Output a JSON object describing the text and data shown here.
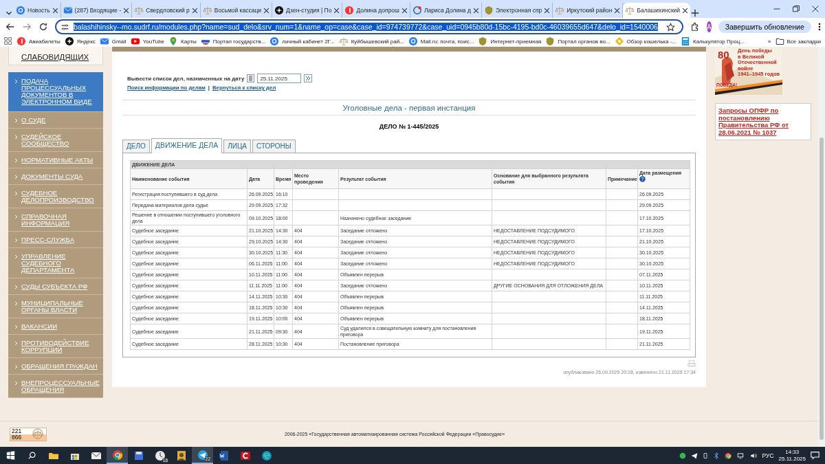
{
  "browser": {
    "tabs": [
      {
        "title": "Новость",
        "selected": false
      },
      {
        "title": "(287) Входящие -",
        "selected": false
      },
      {
        "title": "Свердловский р",
        "selected": false
      },
      {
        "title": "Восьмой кассаци",
        "selected": false
      },
      {
        "title": "Дзен-студия | По",
        "selected": false
      },
      {
        "title": "Долина допрош",
        "selected": false
      },
      {
        "title": "Лариса Долина д",
        "selected": false
      },
      {
        "title": "Электронная спр",
        "selected": false
      },
      {
        "title": "Иркутский район",
        "selected": false
      },
      {
        "title": "Балашихинский",
        "selected": true
      }
    ],
    "url": "balashihinsky--mo.sudrf.ru/modules.php?name=sud_delo&srv_num=1&name_op=case&case_id=974739772&case_uid=0945b80d-15bc-4195-bd0c-46039655d647&delo_id=1540006",
    "profile": "A",
    "update_button": "Завершить обновление",
    "bookmarks": [
      "Авиабилеты",
      "Яндекс",
      "Gmail",
      "YouTube",
      "Карты",
      "Портал государств...",
      "личный кабинет 2Г...",
      "Куйбышевский рай...",
      "Mail.ru: почта, поис...",
      "Интернет-приемная",
      "Портал органов во...",
      "Обзор кошелька -...",
      "Калькулятор Проц..."
    ],
    "more_bookmarks": "»",
    "all_bookmarks": "Все закладки"
  },
  "page": {
    "accessibility_link": "СЛАБОВИДЯЩИХ",
    "sidebar": [
      {
        "label": "ПОДАЧА ПРОЦЕССУАЛЬНЫХ ДОКУМЕНТОВ В ЭЛЕКТРОННОМ ВИДЕ",
        "selected": true
      },
      {
        "label": "О СУДЕ",
        "selected": false
      },
      {
        "label": "СУДЕЙСКОЕ СООБЩЕСТВО",
        "selected": false
      },
      {
        "label": "НОРМАТИВНЫЕ АКТЫ",
        "selected": false
      },
      {
        "label": "ДОКУМЕНТЫ СУДА",
        "selected": false
      },
      {
        "label": "СУДЕБНОЕ ДЕЛОПРОИЗВОДСТВО",
        "selected": false
      },
      {
        "label": "СПРАВОЧНАЯ ИНФОРМАЦИЯ",
        "selected": false
      },
      {
        "label": "ПРЕСС-СЛУЖБА",
        "selected": false
      },
      {
        "label": "УПРАВЛЕНИЕ СУДЕБНОГО ДЕПАРТАМЕНТА",
        "selected": false
      },
      {
        "label": "СУДЫ СУБЪЕКТА РФ",
        "selected": false
      },
      {
        "label": "МУНИЦИПАЛЬНЫЕ ОРГАНЫ ВЛАСТИ",
        "selected": false
      },
      {
        "label": "ВАКАНСИИ",
        "selected": false
      },
      {
        "label": "ПРОТИВОДЕЙСТВИЕ КОРРУПЦИИ",
        "selected": false
      },
      {
        "label": "ОБРАЩЕНИЯ ГРАЖДАН",
        "selected": false
      },
      {
        "label": "ВНЕПРОЦЕССУАЛЬНЫЕ ОБРАЩЕНИЯ",
        "selected": false
      }
    ],
    "date_filter": {
      "label": "Вывести список дел, назначенных на дату",
      "value": "25.11.2025"
    },
    "links": [
      "Поиск информации по делам",
      "Вернуться к списку дел"
    ],
    "link_separator": "|",
    "section_title": "Уголовные дела - первая инстанция",
    "case_title": "ДЕЛО № 1-445/2025",
    "case_tabs": [
      {
        "label": "ДЕЛО",
        "selected": false
      },
      {
        "label": "ДВИЖЕНИЕ ДЕЛА",
        "selected": true
      },
      {
        "label": "ЛИЦА",
        "selected": false
      },
      {
        "label": "СТОРОНЫ",
        "selected": false
      }
    ],
    "table": {
      "caption": "ДВИЖЕНИЕ ДЕЛА",
      "columns": [
        "Наименование события",
        "Дата",
        "Время",
        "Место проведения",
        "Результат события",
        "Основание для выбранного результата события",
        "Примечание",
        "Дата размещения"
      ],
      "rows": [
        [
          "Регистрация поступившего в суд дела",
          "26.09.2025",
          "16:10",
          "",
          "",
          "",
          "",
          "26.09.2025"
        ],
        [
          "Передача материалов дела судье",
          "29.09.2025",
          "17:32",
          "",
          "",
          "",
          "",
          "29.09.2025"
        ],
        [
          "Решение в отношении поступившего уголовного дела",
          "09.10.2025",
          "18:00",
          "",
          "Назначено судебное заседание",
          "",
          "",
          "17.10.2025"
        ],
        [
          "Судебное заседание",
          "21.10.2025",
          "14:30",
          "404",
          "Заседание отложено",
          "НЕДОСТАВЛЕНИЕ ПОДСУДИМОГО",
          "",
          "17.10.2025"
        ],
        [
          "Судебное заседание",
          "29.10.2025",
          "14:30",
          "404",
          "Заседание отложено",
          "НЕДОСТАВЛЕНИЕ ПОДСУДИМОГО",
          "",
          "21.10.2025"
        ],
        [
          "Судебное заседание",
          "30.10.2025",
          "11:30",
          "404",
          "Заседание отложено",
          "НЕДОСТАВЛЕНИЕ ПОДСУДИМОГО",
          "",
          "30.10.2025"
        ],
        [
          "Судебное заседание",
          "06.11.2025",
          "11:00",
          "404",
          "Заседание отложено",
          "НЕДОСТАВЛЕНИЕ ПОДСУДИМОГО",
          "",
          "30.10.2025"
        ],
        [
          "Судебное заседание",
          "10.11.2025",
          "11:00",
          "404",
          "Объявлен перерыв",
          "",
          "",
          "07.11.2025"
        ],
        [
          "Судебное заседание",
          "11.11.2025",
          "11:00",
          "404",
          "Заседание отложено",
          "ДРУГИЕ ОСНОВАНИЯ ДЛЯ ОТЛОЖЕНИЯ ДЕЛА",
          "",
          "10.11.2025"
        ],
        [
          "Судебное заседание",
          "14.11.2025",
          "10:30",
          "404",
          "Объявлен перерыв",
          "",
          "",
          "11.11.2025"
        ],
        [
          "Судебное заседание",
          "18.11.2025",
          "10:30",
          "404",
          "Объявлен перерыв",
          "",
          "",
          "14.11.2025"
        ],
        [
          "Судебное заседание",
          "19.11.2025",
          "10:00",
          "404",
          "Объявлен перерыв",
          "",
          "",
          "18.11.2025"
        ],
        [
          "Судебное заседание",
          "21.11.2025",
          "09:30",
          "404",
          "Суд удалился в совещательную комнату для постановления приговора",
          "",
          "",
          "19.11.2025"
        ],
        [
          "Судебное заседание",
          "28.11.2025",
          "10:30",
          "404",
          "Постановление приговора",
          "",
          "",
          "21.11.2025"
        ]
      ]
    },
    "published": "опубликовано 26.09.2025 20:28, изменено 21.11.2025 17:34",
    "banner": {
      "kind": "picture",
      "number": "80",
      "slogan": "ПОБЕДА!",
      "lines": [
        "День победы",
        "в Великой",
        "Отечественной войне",
        "1941–1945 годов"
      ]
    },
    "side_link": "Запросы ОПФР по постановлению Правительства РФ от 28.06.2021 № 1037",
    "counter": [
      "221",
      "866"
    ],
    "footer": "2006-2025 «Государственная автоматизированная система Российской Федерации «Правосудие»"
  },
  "taskbar": {
    "apps": [
      {
        "selected": false
      },
      {
        "selected": false
      },
      {
        "selected": false
      },
      {
        "selected": true
      },
      {
        "selected": false
      },
      {
        "selected": false,
        "badge": "16"
      },
      {
        "selected": false
      },
      {
        "selected": true,
        "badge": "22"
      },
      {
        "selected": false
      },
      {
        "selected": false
      },
      {
        "selected": false
      }
    ],
    "language": "РУС",
    "time": "14:33",
    "date": "25.11.2025"
  }
}
